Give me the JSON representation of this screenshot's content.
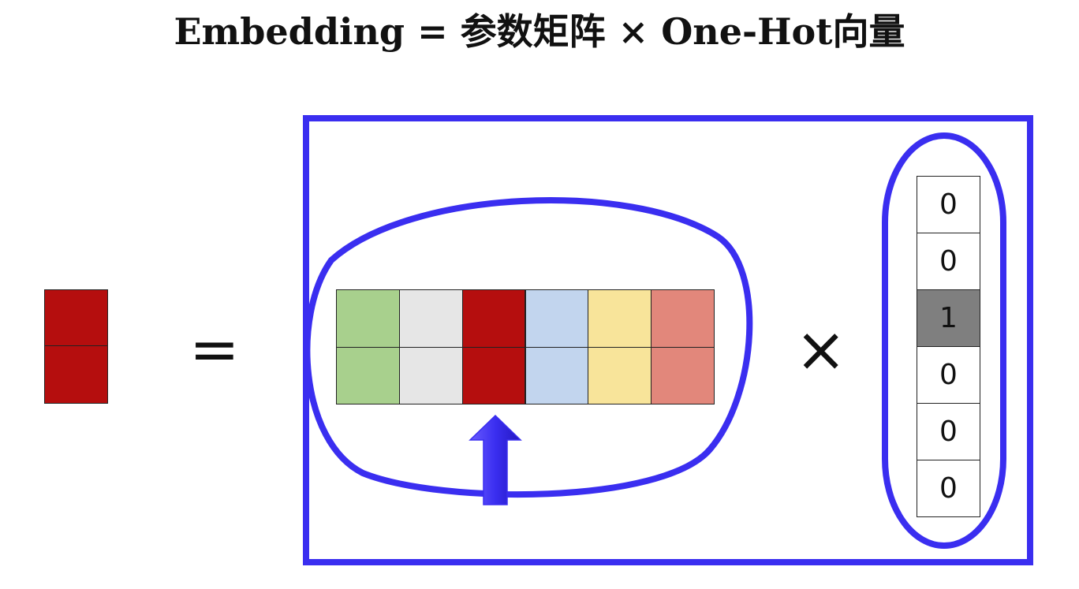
{
  "title": "Embedding = 参数矩阵 × One-Hot向量",
  "operators": {
    "equals": "=",
    "times": "×"
  },
  "result_vector": {
    "rows": 2,
    "color": "#b50e0e"
  },
  "parameter_matrix": {
    "rows": 2,
    "columns": [
      {
        "color": "#a8d08d"
      },
      {
        "color": "#e6e6e6"
      },
      {
        "color": "#b50e0e"
      },
      {
        "color": "#c2d5ee"
      },
      {
        "color": "#f8e49a"
      },
      {
        "color": "#e2877b"
      }
    ],
    "selected_column": 2
  },
  "one_hot": {
    "values": [
      "0",
      "0",
      "1",
      "0",
      "0",
      "0"
    ],
    "active_color": "#7f7f7f"
  },
  "colors": {
    "outline": "#3a2ef0",
    "arrow": "#3a2ef0"
  }
}
